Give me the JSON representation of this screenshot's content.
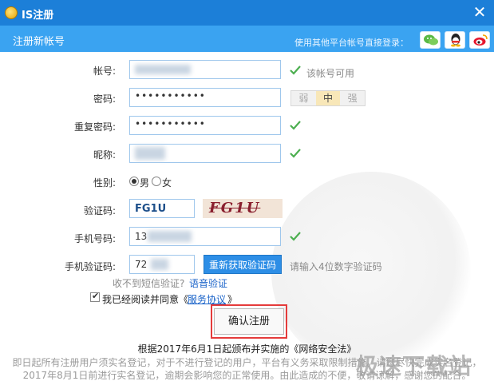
{
  "window": {
    "title": "IS注册",
    "close_glyph": "✕"
  },
  "header": {
    "title": "注册新帐号",
    "social_hint": "使用其他平台帐号直接登录：",
    "social": [
      "wechat-icon",
      "qq-icon",
      "weibo-icon"
    ]
  },
  "form": {
    "account": {
      "label": "帐号:",
      "status": "该帐号可用"
    },
    "password": {
      "label": "密码:",
      "value": "•••••••••••",
      "strength": [
        "弱",
        "中",
        "强"
      ],
      "strength_level": "中"
    },
    "repeat": {
      "label": "重复密码:",
      "value": "•••••••••••"
    },
    "nickname": {
      "label": "昵称:"
    },
    "gender": {
      "label": "性别:",
      "options": [
        "男",
        "女"
      ],
      "selected": "男"
    },
    "captcha": {
      "label": "验证码:",
      "value": "FG1U",
      "image_text": "FG1U"
    },
    "phone": {
      "label": "手机号码:",
      "value": "13"
    },
    "sms": {
      "label": "手机验证码:",
      "value": "72",
      "button": "重新获取验证码",
      "hint": "请输入4位数字验证码"
    },
    "voice": {
      "text": "收不到短信验证?",
      "link": "语音验证"
    },
    "agree": {
      "text": "我已经阅读并同意《",
      "link": "服务协议",
      "end": "》",
      "checked": true
    },
    "submit": "确认注册"
  },
  "notice": {
    "title": "根据2017年6月1日起颁布并实施的《网络安全法》",
    "line1": "即日起所有注册用户须实名登记，对于不进行登记的用户，平台有义务采取限制措施。请您尽快完成实名登记，",
    "line2": "2017年8月1日前进行实名登记，逾期会影响您的正常使用。由此造成的不便，敬请谅解，感谢您的配合。"
  },
  "watermark": "极速下载站",
  "colors": {
    "titlebar": "#1c7fd8",
    "subbar": "#3aa3f1",
    "check": "#4caf50",
    "button": "#2d8ee6",
    "highlight": "#e53b3b"
  }
}
